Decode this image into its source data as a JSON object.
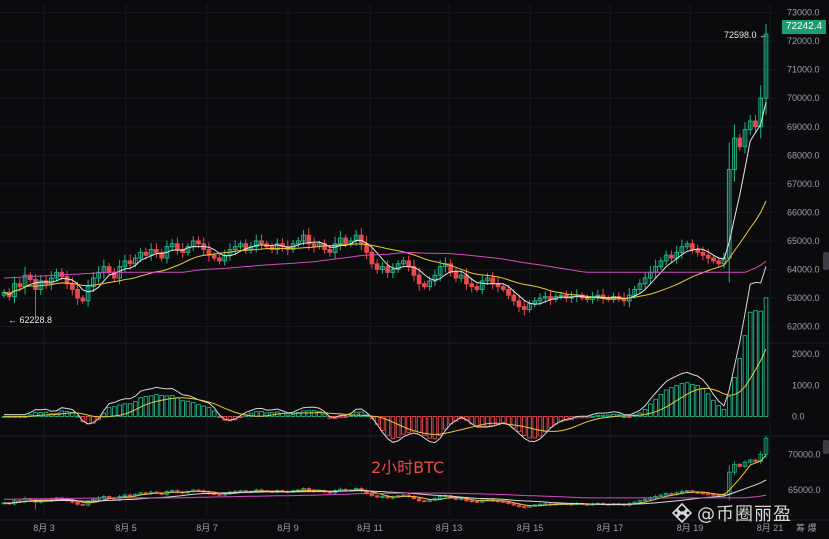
{
  "chart_data": [
    {
      "type": "candlestick",
      "interval_label": "2小时BTC",
      "y_ticks": [
        62000,
        63000,
        64000,
        65000,
        66000,
        67000,
        68000,
        69000,
        70000,
        71000,
        72000,
        73000
      ],
      "y_tick_labels": [
        "62000.0",
        "63000.0",
        "64000.0",
        "65000.0",
        "66000.0",
        "67000.0",
        "68000.0",
        "69000.0",
        "70000.0",
        "71000.0",
        "72000.0",
        "73000.0"
      ],
      "ylim": [
        61600,
        73300
      ],
      "last_price_label": "72242.4",
      "last_price": 72242.4,
      "high_label": "72598.0",
      "high_value": 72598.0,
      "low_label": "62228.8",
      "low_value": 62228.8,
      "candles_closes": [
        63200,
        63050,
        63500,
        63400,
        63800,
        63650,
        63300,
        63600,
        63500,
        63700,
        63900,
        63750,
        63500,
        63300,
        63000,
        62900,
        63400,
        63700,
        63900,
        64100,
        63900,
        63700,
        64100,
        64300,
        64200,
        64400,
        64600,
        64500,
        64700,
        64600,
        64400,
        64800,
        64900,
        64700,
        64600,
        64800,
        65000,
        64900,
        64700,
        64500,
        64400,
        64300,
        64500,
        64700,
        64800,
        64900,
        64700,
        64800,
        65000,
        64900,
        64800,
        64700,
        64900,
        64800,
        64700,
        64900,
        65000,
        65200,
        64900,
        64800,
        64900,
        64700,
        64600,
        64900,
        65100,
        64900,
        65000,
        65200,
        64900,
        64600,
        64200,
        64000,
        64100,
        63900,
        64000,
        64200,
        64300,
        64100,
        63800,
        63500,
        63400,
        63600,
        63800,
        64100,
        64200,
        63900,
        63700,
        63800,
        63500,
        63400,
        63300,
        63600,
        63700,
        63500,
        63400,
        63300,
        63100,
        62900,
        62700,
        62600,
        62800,
        62900,
        63000,
        63050,
        62950,
        63050,
        63100,
        63000,
        63050,
        63100,
        63000,
        62950,
        63050,
        63100,
        63000,
        62950,
        63050,
        63000,
        62900,
        63100,
        63300,
        63500,
        63700,
        63900,
        64100,
        64300,
        64500,
        64400,
        64600,
        64800,
        64900,
        64700,
        64600,
        64500,
        64400,
        64300,
        64200,
        64400,
        67500,
        68600,
        68300,
        68900,
        69200,
        69000,
        70000,
        72242.4
      ]
    },
    {
      "type": "bar",
      "name": "histogram",
      "y_tick_labels": [
        "2000.0",
        "1000.0",
        "0.0"
      ],
      "y_ticks": [
        2000,
        1000,
        0
      ],
      "ylim": [
        -500,
        2200
      ]
    },
    {
      "type": "line",
      "name": "lower",
      "y_tick_labels": [
        "70000.0",
        "65000.0"
      ],
      "y_ticks": [
        70000,
        65000
      ],
      "ylim": [
        61500,
        72000
      ]
    }
  ],
  "x_axis": {
    "labels": [
      "8月 3",
      "8月 5",
      "8月 7",
      "8月 9",
      "8月 11",
      "8月 13",
      "8月 15",
      "8月 17",
      "8月 19",
      "8月 21"
    ],
    "corner_icons": "筹 爆"
  },
  "watermark": {
    "text": "@币圈丽盈"
  },
  "colors": {
    "background": "#0b0b0e",
    "up": "#1fb58a",
    "down": "#e84a4a",
    "ma_fast": "#e7e7e7",
    "ma_mid": "#e9c93a",
    "ma_slow": "#d24ac0",
    "grid": "#17181c"
  }
}
